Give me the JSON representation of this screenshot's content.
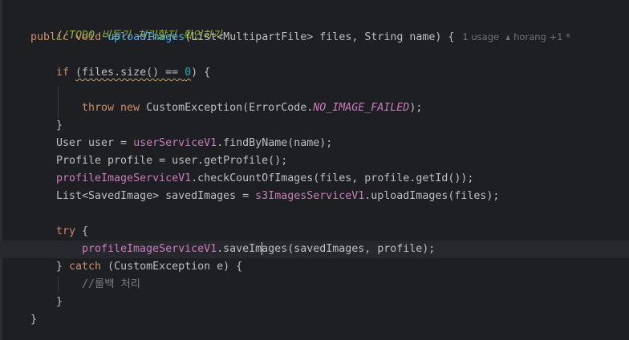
{
  "code_lines": {
    "l1_todo": "//TODO 비동기 처리할지 확인하기",
    "l2_public": "public",
    "l2_void": "void",
    "l2_method": "uploadImages",
    "l2_params": "(List<MultipartFile> files, String name) {",
    "l2_usage_hint": "1 usage",
    "l2_author_hint": "horang +1 *",
    "l3_if": "if",
    "l3_files_call": "(files.size()",
    "l3_eq": " == ",
    "l3_zero": "0",
    "l3_close": ") {",
    "l4_throw": "throw",
    "l4_new": "new",
    "l4_ctor": " CustomException(ErrorCode.",
    "l4_const": "NO_IMAGE_FAILED",
    "l4_end": ");",
    "l5_brace": "}",
    "l6_a": "User user = ",
    "l6_field": "userServiceV1",
    "l6_b": ".findByName(name);",
    "l7": "Profile profile = user.getProfile();",
    "l8_field": "profileImageServiceV1",
    "l8_b": ".checkCountOfImages(files, profile.getId());",
    "l9_a": "List<SavedImage> savedImages = ",
    "l9_field": "s3ImagesServiceV1",
    "l9_b": ".uploadImages(files);",
    "l10_try": "try",
    "l10_brace": " {",
    "l11_field": "profileImageServiceV1",
    "l11_b1": ".saveIm",
    "l11_b2": "ages(savedImages, profile);",
    "l12_a": "} ",
    "l12_catch": "catch",
    "l12_b": " (CustomException e) {",
    "l13_cmt": "//롤백 처리",
    "l14_brace": "}",
    "l15_brace": "}"
  },
  "colors": {
    "background": "#1e1f22",
    "keyword": "#cf8e6d",
    "method_declaration": "#56a8f5",
    "field": "#c77dbb",
    "number": "#2aacb8",
    "comment": "#7a7e85",
    "todo": "#8bb33d"
  },
  "icons": {
    "author_hint_icon": "person-icon"
  }
}
